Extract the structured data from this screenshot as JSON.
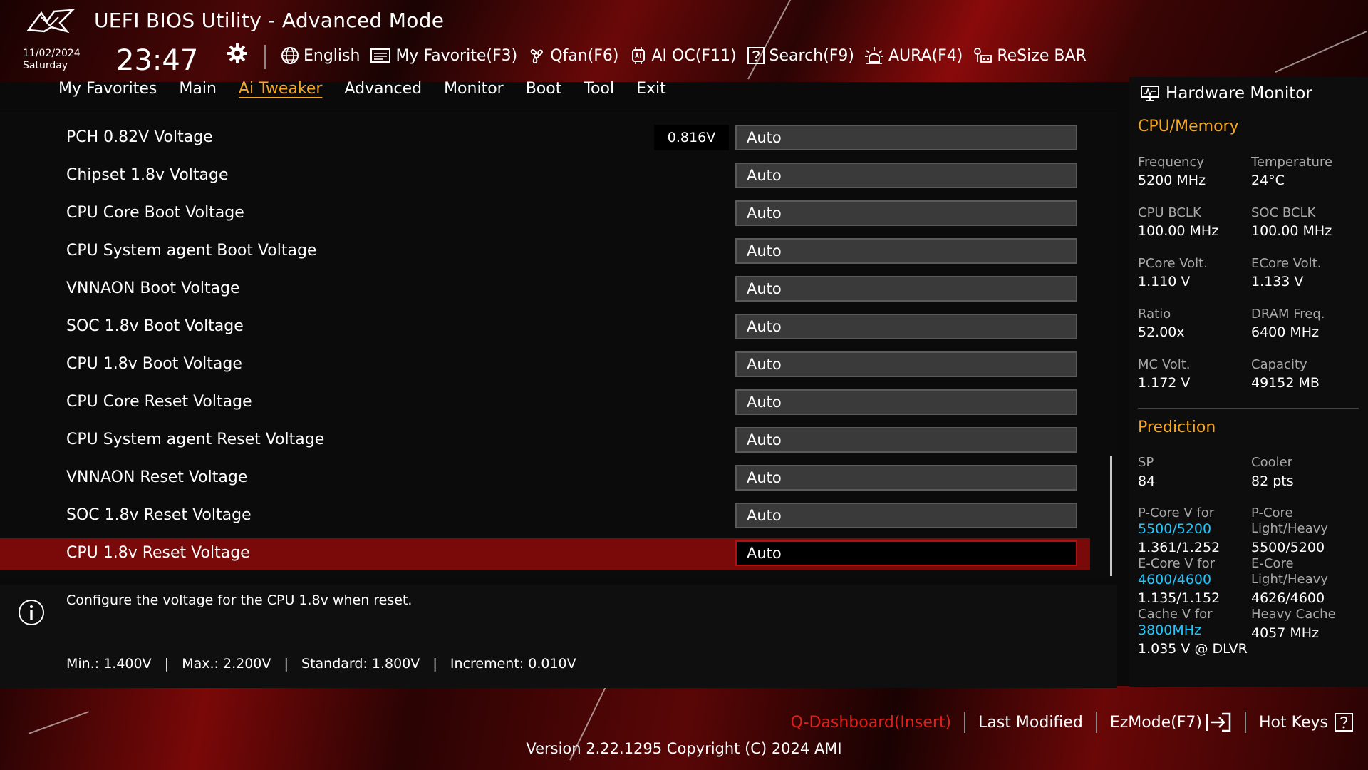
{
  "header": {
    "title": "UEFI BIOS Utility - Advanced Mode",
    "date": "11/02/2024",
    "day": "Saturday",
    "time": "23:47"
  },
  "toolbar": {
    "language": "English",
    "my_favorite": "My Favorite(F3)",
    "qfan": "Qfan(F6)",
    "ai_oc": "AI OC(F11)",
    "search": "Search(F9)",
    "aura": "AURA(F4)",
    "resize_bar": "ReSize BAR"
  },
  "menu": {
    "items": [
      "My Favorites",
      "Main",
      "Ai Tweaker",
      "Advanced",
      "Monitor",
      "Boot",
      "Tool",
      "Exit"
    ],
    "active": "Ai Tweaker"
  },
  "settings": [
    {
      "label": "PCH 0.82V Voltage",
      "readout": "0.816V",
      "value": "Auto"
    },
    {
      "label": "Chipset 1.8v Voltage",
      "value": "Auto"
    },
    {
      "label": "CPU Core Boot Voltage",
      "value": "Auto"
    },
    {
      "label": "CPU System agent Boot Voltage",
      "value": "Auto"
    },
    {
      "label": "VNNAON Boot Voltage",
      "value": "Auto"
    },
    {
      "label": "SOC 1.8v Boot Voltage",
      "value": "Auto"
    },
    {
      "label": "CPU 1.8v Boot Voltage",
      "value": "Auto"
    },
    {
      "label": "CPU Core Reset Voltage",
      "value": "Auto"
    },
    {
      "label": "CPU System agent Reset Voltage",
      "value": "Auto"
    },
    {
      "label": "VNNAON Reset Voltage",
      "value": "Auto"
    },
    {
      "label": "SOC 1.8v Reset Voltage",
      "value": "Auto"
    },
    {
      "label": "CPU 1.8v Reset Voltage",
      "value": "Auto",
      "selected": true
    }
  ],
  "help": {
    "description": "Configure the voltage for the CPU 1.8v when reset.",
    "range": "Min.: 1.400V   |   Max.: 2.200V   |   Standard: 1.800V   |   Increment: 0.010V"
  },
  "hardware_monitor": {
    "title": "Hardware Monitor",
    "cpu_memory_heading": "CPU/Memory",
    "frequency_label": "Frequency",
    "frequency": "5200 MHz",
    "temperature_label": "Temperature",
    "temperature": "24°C",
    "cpu_bclk_label": "CPU BCLK",
    "cpu_bclk": "100.00 MHz",
    "soc_bclk_label": "SOC BCLK",
    "soc_bclk": "100.00 MHz",
    "pcore_volt_label": "PCore Volt.",
    "pcore_volt": "1.110 V",
    "ecore_volt_label": "ECore Volt.",
    "ecore_volt": "1.133 V",
    "ratio_label": "Ratio",
    "ratio": "52.00x",
    "dram_freq_label": "DRAM Freq.",
    "dram_freq": "6400 MHz",
    "mc_volt_label": "MC Volt.",
    "mc_volt": "1.172 V",
    "capacity_label": "Capacity",
    "capacity": "49152 MB",
    "prediction_heading": "Prediction",
    "sp_label": "SP",
    "sp": "84",
    "cooler_label": "Cooler",
    "cooler": "82 pts",
    "pcore_v_for_label": "P-Core V for",
    "pcore_v_for_freq": "5500/5200",
    "pcore_v_for_value": "1.361/1.252",
    "pcore_lh_label_1": "P-Core",
    "pcore_lh_label_2": "Light/Heavy",
    "pcore_lh_value": "5500/5200",
    "ecore_v_for_label": "E-Core V for",
    "ecore_v_for_freq": "4600/4600",
    "ecore_v_for_value": "1.135/1.152",
    "ecore_lh_label_1": "E-Core",
    "ecore_lh_label_2": "Light/Heavy",
    "ecore_lh_value": "4626/4600",
    "cache_v_for_label": "Cache V for",
    "cache_v_for_freq": "3800MHz",
    "cache_v_for_value": "1.035 V @ DLVR",
    "heavy_cache_label": "Heavy Cache",
    "heavy_cache_value": "4057 MHz"
  },
  "footer": {
    "q_dashboard": "Q-Dashboard(Insert)",
    "last_modified": "Last Modified",
    "ezmode": "EzMode(F7)",
    "hot_keys": "Hot Keys",
    "version": "Version 2.22.1295 Copyright (C) 2024 AMI"
  },
  "colors": {
    "accent": "#f5a623",
    "selected_row": "#7a0a0a",
    "cyan": "#1ec8ff",
    "q_dashboard": "#e0201a"
  },
  "icons": [
    "rog-logo-icon",
    "gear-icon",
    "globe-icon",
    "favorite-list-icon",
    "fan-icon",
    "ai-chip-icon",
    "search-question-icon",
    "aura-light-icon",
    "resize-bar-icon",
    "monitor-icon",
    "info-icon",
    "ezmode-exit-icon",
    "hotkeys-question-icon"
  ]
}
